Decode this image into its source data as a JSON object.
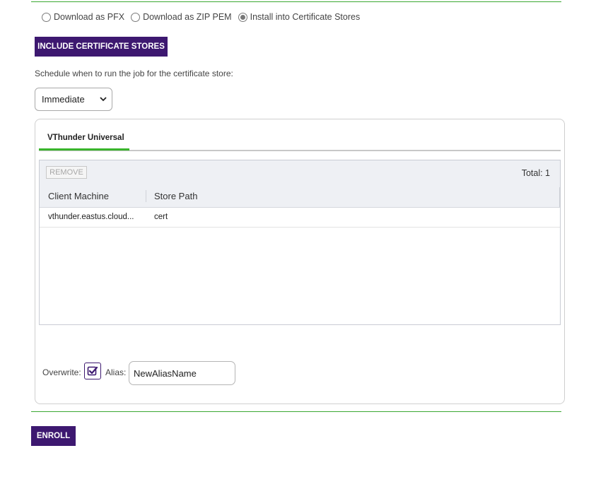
{
  "delivery_options": [
    {
      "label": "Download as PFX",
      "checked": false
    },
    {
      "label": "Download as ZIP PEM",
      "checked": false
    },
    {
      "label": "Install into Certificate Stores",
      "checked": true
    }
  ],
  "include_button_label": "INCLUDE CERTIFICATE STORES",
  "schedule": {
    "label": "Schedule when to run the job for the certificate store:",
    "selected": "Immediate"
  },
  "tabs": [
    {
      "label": "VThunder Universal",
      "active": true
    }
  ],
  "grid": {
    "remove_label": "REMOVE",
    "total_text": "Total: 1",
    "columns": [
      "Client Machine",
      "Store Path"
    ],
    "rows": [
      {
        "client_machine": "vthunder.eastus.cloud...",
        "store_path": "cert"
      }
    ]
  },
  "options": {
    "overwrite_label": "Overwrite:",
    "overwrite_checked": true,
    "alias_label": "Alias:",
    "alias_value": "NewAliasName"
  },
  "enroll_label": "ENROLL",
  "colors": {
    "accent": "#3d1870",
    "divider": "#3aa832",
    "tab_active": "#3ab52c"
  }
}
